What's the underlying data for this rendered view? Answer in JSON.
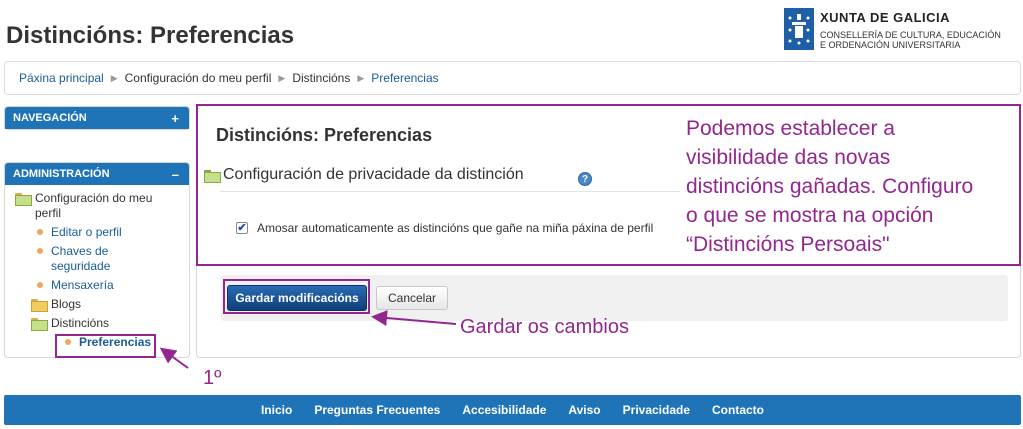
{
  "page": {
    "title": "Distincións: Preferencias"
  },
  "logo": {
    "title": "XUNTA DE GALICIA",
    "subtitle_line1": "CONSELLERÍA DE CULTURA, EDUCACIÓN",
    "subtitle_line2": "E ORDENACIÓN UNIVERSITARIA"
  },
  "breadcrumb": [
    {
      "label": "Páxina principal",
      "link": true
    },
    {
      "label": "Configuración do meu perfil",
      "link": false
    },
    {
      "label": "Distincións",
      "link": false
    },
    {
      "label": "Preferencias",
      "link": true
    }
  ],
  "navigation": {
    "header": "NAVEGACIÓN",
    "toggle": "+"
  },
  "administration": {
    "header": "ADMINISTRACIÓN",
    "toggle": "–",
    "root_label": "Configuración do meu perfil",
    "root_label_line1": "Configuración do meu",
    "root_label_line2": "perfil",
    "items": [
      {
        "label": "Editar o perfil"
      },
      {
        "label_line1": "Chaves de",
        "label_line2": "seguridade"
      },
      {
        "label": "Mensaxería"
      }
    ],
    "blogs": "Blogs",
    "distinctions": "Distincións",
    "preferences": "Preferencias"
  },
  "main": {
    "title": "Distincións: Preferencias",
    "section_title": "Configuración de privacidade da distinción",
    "help_icon": "?",
    "checkbox_label": "Amosar automaticamente as distincións que gañe na miña páxina de perfil",
    "checkbox_checked": true,
    "save_button": "Gardar modificacións",
    "cancel_button": "Cancelar"
  },
  "annotations": {
    "main_note_line1": "Podemos establecer a",
    "main_note_line2": "visibilidade das novas",
    "main_note_line3": "distincións gañadas. Configuro",
    "main_note_line4": "o que se mostra na opción",
    "main_note_line5": "“Distincións Persoais\"",
    "save_note": "Gardar os cambios",
    "step_note": "1º",
    "color": "#93278f"
  },
  "footer": {
    "links": [
      "Inicio",
      "Preguntas Frecuentes",
      "Accesibilidade",
      "Aviso",
      "Privacidade",
      "Contacto"
    ]
  },
  "colors": {
    "brand_blue": "#1f74b8",
    "link": "#1a5c96",
    "save_button": "#114b8c"
  }
}
